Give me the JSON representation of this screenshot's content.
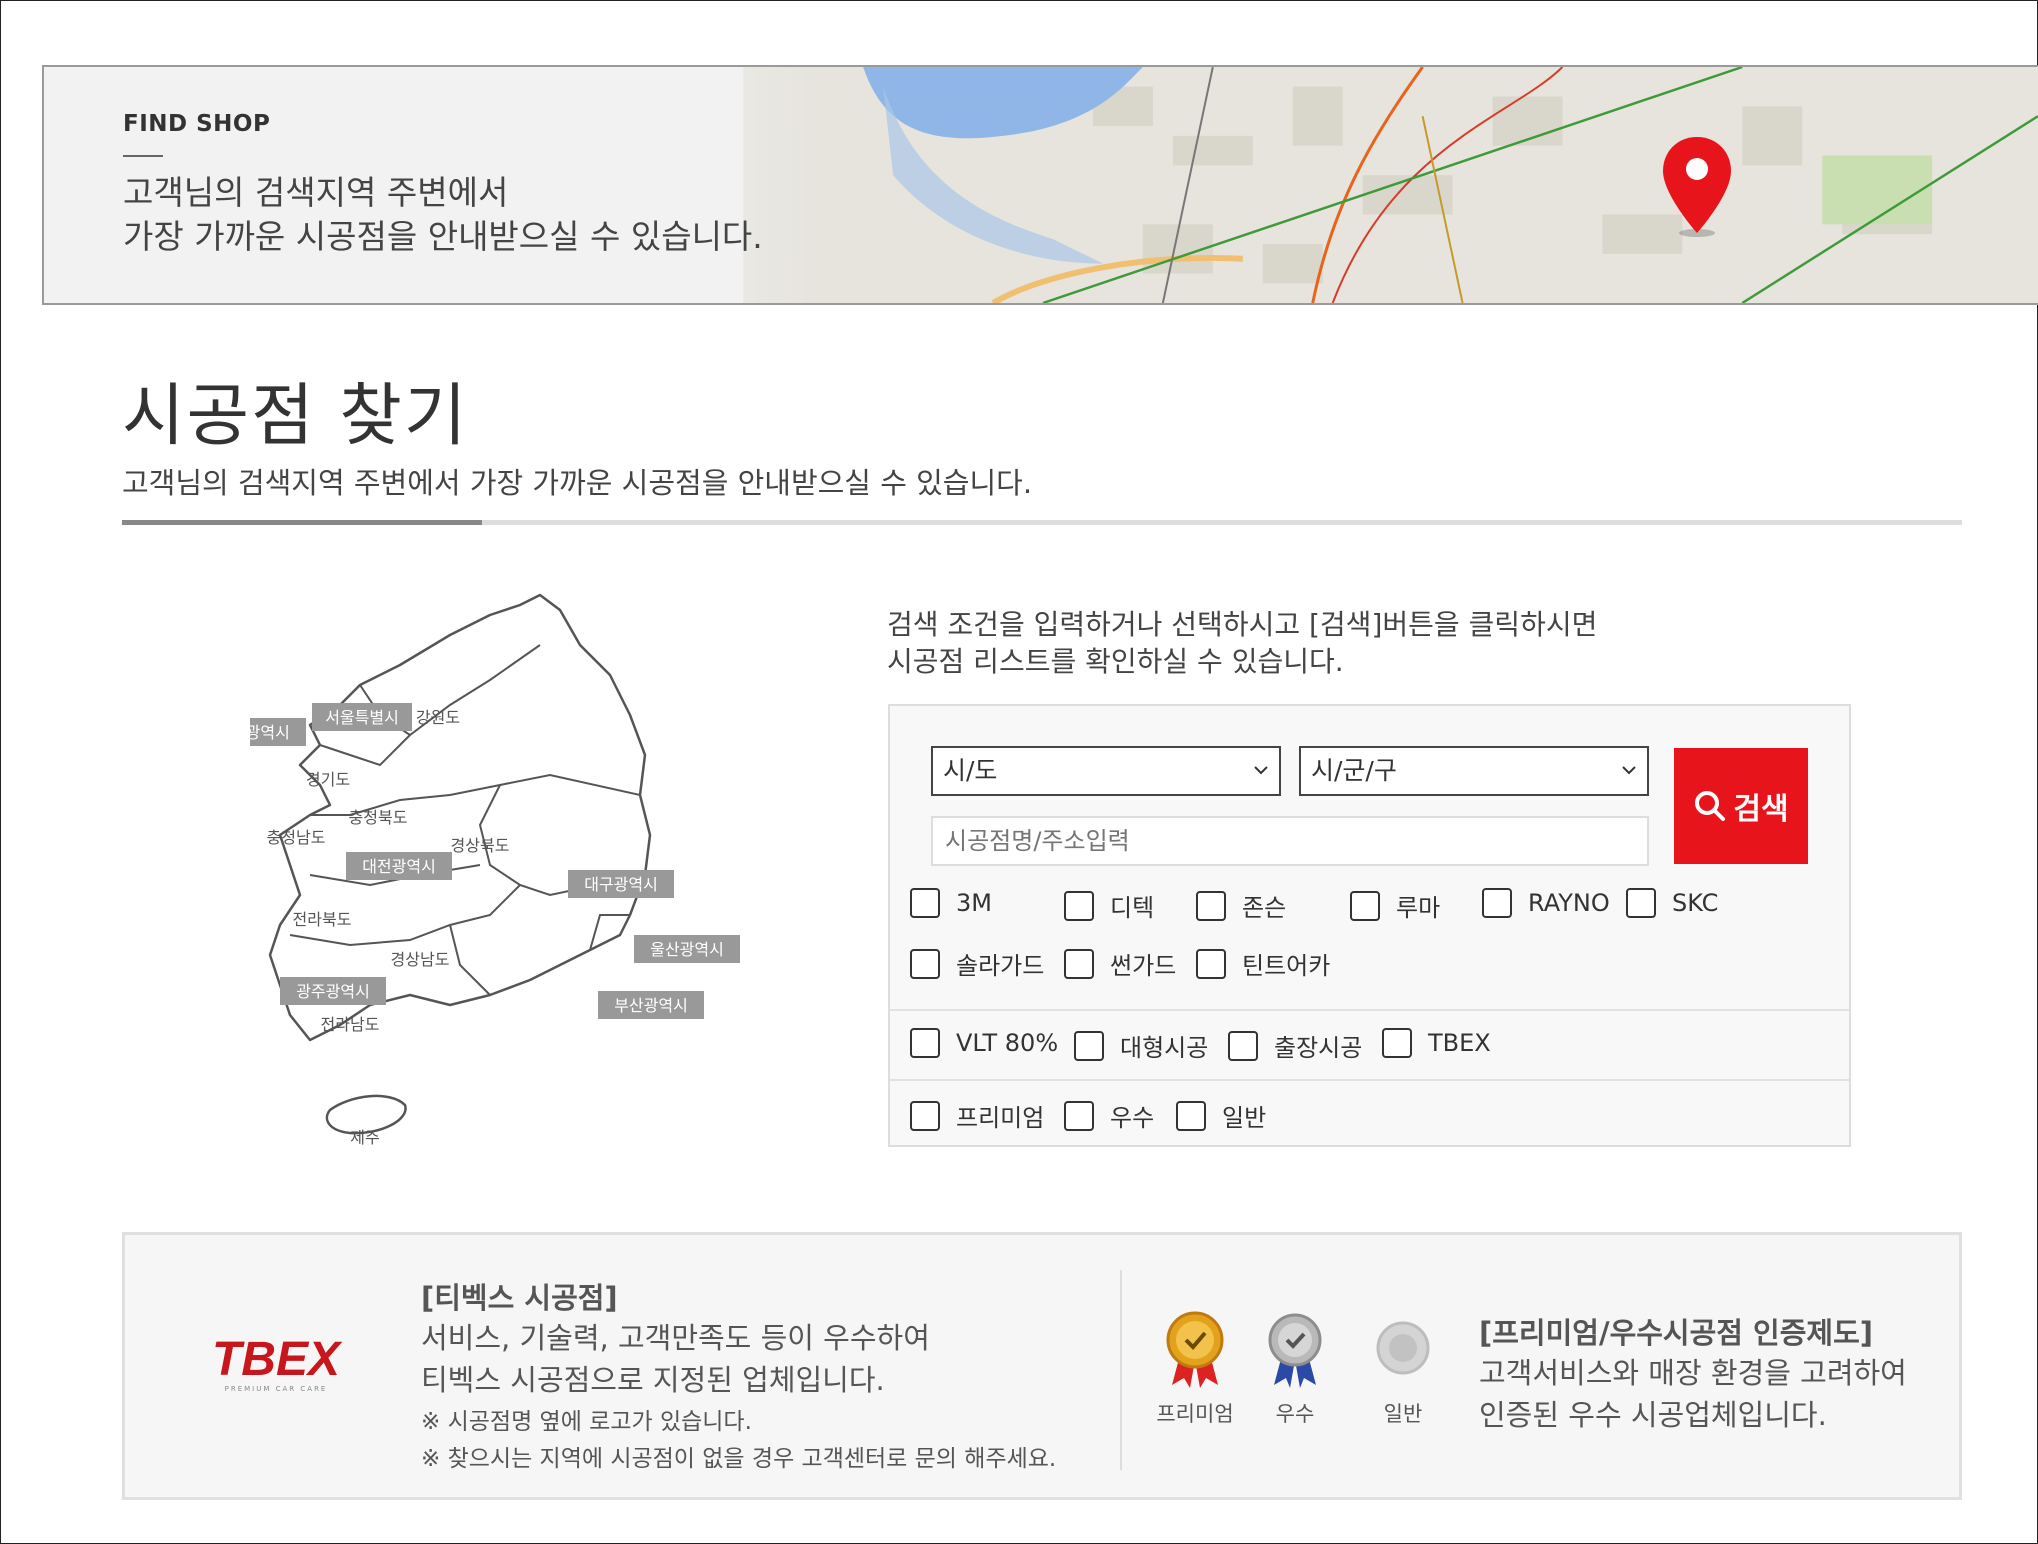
{
  "banner": {
    "eyebrow": "FIND SHOP",
    "line1": "고객님의 검색지역 주변에서",
    "line2": "가장 가까운 시공점을 안내받으실 수 있습니다."
  },
  "page": {
    "title": "시공점 찾기",
    "subtitle": "고객님의 검색지역 주변에서 가장 가까운 시공점을 안내받으실 수 있습니다."
  },
  "map": {
    "regions": {
      "seoul": "서울특별시",
      "gangwon": "강원도",
      "incheon": "인천광역시",
      "gyeonggi": "경기도",
      "chungbuk": "충청북도",
      "chungnam": "충청남도",
      "gyeongbuk": "경상북도",
      "daejeon": "대전광역시",
      "daegu": "대구광역시",
      "jeonbuk": "전라북도",
      "ulsan": "울산광역시",
      "gyeongnam": "경상남도",
      "gwangju": "광주광역시",
      "busan": "부산광역시",
      "jeonnam": "전라남도",
      "jeju": "제주"
    }
  },
  "search": {
    "intro1": "검색 조건을 입력하거나 선택하시고 [검색]버튼을 클릭하시면",
    "intro2": "시공점 리스트를 확인하실 수 있습니다.",
    "sido": "시/도",
    "sigungu": "시/군/구",
    "placeholder": "시공점명/주소입력",
    "button": "검색",
    "brands": [
      "3M",
      "디텍",
      "존슨",
      "루마",
      "RAYNO",
      "SKC",
      "솔라가드",
      "썬가드",
      "틴트어카"
    ],
    "services": [
      "VLT 80%",
      "대형시공",
      "출장시공",
      "TBEX"
    ],
    "grades": [
      "프리미엄",
      "우수",
      "일반"
    ]
  },
  "info": {
    "logo_text": "TBEX",
    "logo_sub": "PREMIUM CAR CARE",
    "tbex_title": "[티벡스 시공점]",
    "tbex_desc1": "서비스, 기술력, 고객만족도 등이 우수하여",
    "tbex_desc2": "티벡스 시공점으로 지정된 업체입니다.",
    "note1": "※ 시공점명 옆에 로고가 있습니다.",
    "note2": "※ 찾으시는 지역에 시공점이 없을 경우 고객센터로 문의 해주세요.",
    "medal_premium": "프리미엄",
    "medal_excellent": "우수",
    "medal_general": "일반",
    "cert_title": "[프리미엄/우수시공점 인증제도]",
    "cert_desc1": "고객서비스와 매장 환경을 고려하여",
    "cert_desc2": "인증된 우수 시공업체입니다."
  },
  "colors": {
    "accent_red": "#e8141c",
    "logo_red": "#c8161d",
    "gold": "#e2a21c"
  }
}
